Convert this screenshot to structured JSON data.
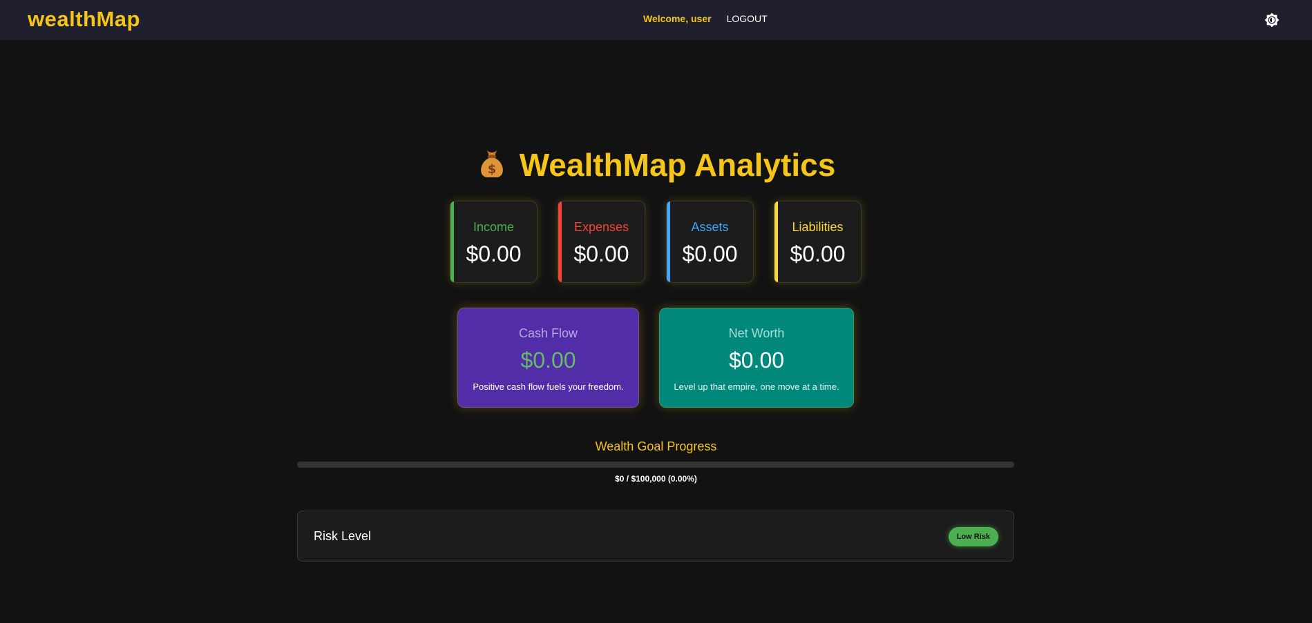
{
  "header": {
    "brand": "wealthMap",
    "welcome": "Welcome, user",
    "logout": "LOGOUT",
    "theme_icon": "brightness-icon"
  },
  "title": {
    "icon": "money-bag-icon",
    "text": "WealthMap Analytics"
  },
  "stats": [
    {
      "label": "Income",
      "value": "$0.00",
      "color": "#4caf50"
    },
    {
      "label": "Expenses",
      "value": "$0.00",
      "color": "#f44336"
    },
    {
      "label": "Assets",
      "value": "$0.00",
      "color": "#42a5f5"
    },
    {
      "label": "Liabilities",
      "value": "$0.00",
      "color": "#fdd835"
    }
  ],
  "summary": {
    "cash_flow": {
      "label": "Cash Flow",
      "value": "$0.00",
      "note": "Positive cash flow fuels your freedom.",
      "bg": "#512da8",
      "value_color": "#66bb6a"
    },
    "net_worth": {
      "label": "Net Worth",
      "value": "$0.00",
      "note": "Level up that empire, one move at a time.",
      "bg": "#00897b",
      "value_color": "#ffffff"
    }
  },
  "goal": {
    "title": "Wealth Goal Progress",
    "text": "$0 / $100,000 (0.00%)",
    "progress": 0
  },
  "risk": {
    "label": "Risk Level",
    "badge": "Low Risk"
  }
}
